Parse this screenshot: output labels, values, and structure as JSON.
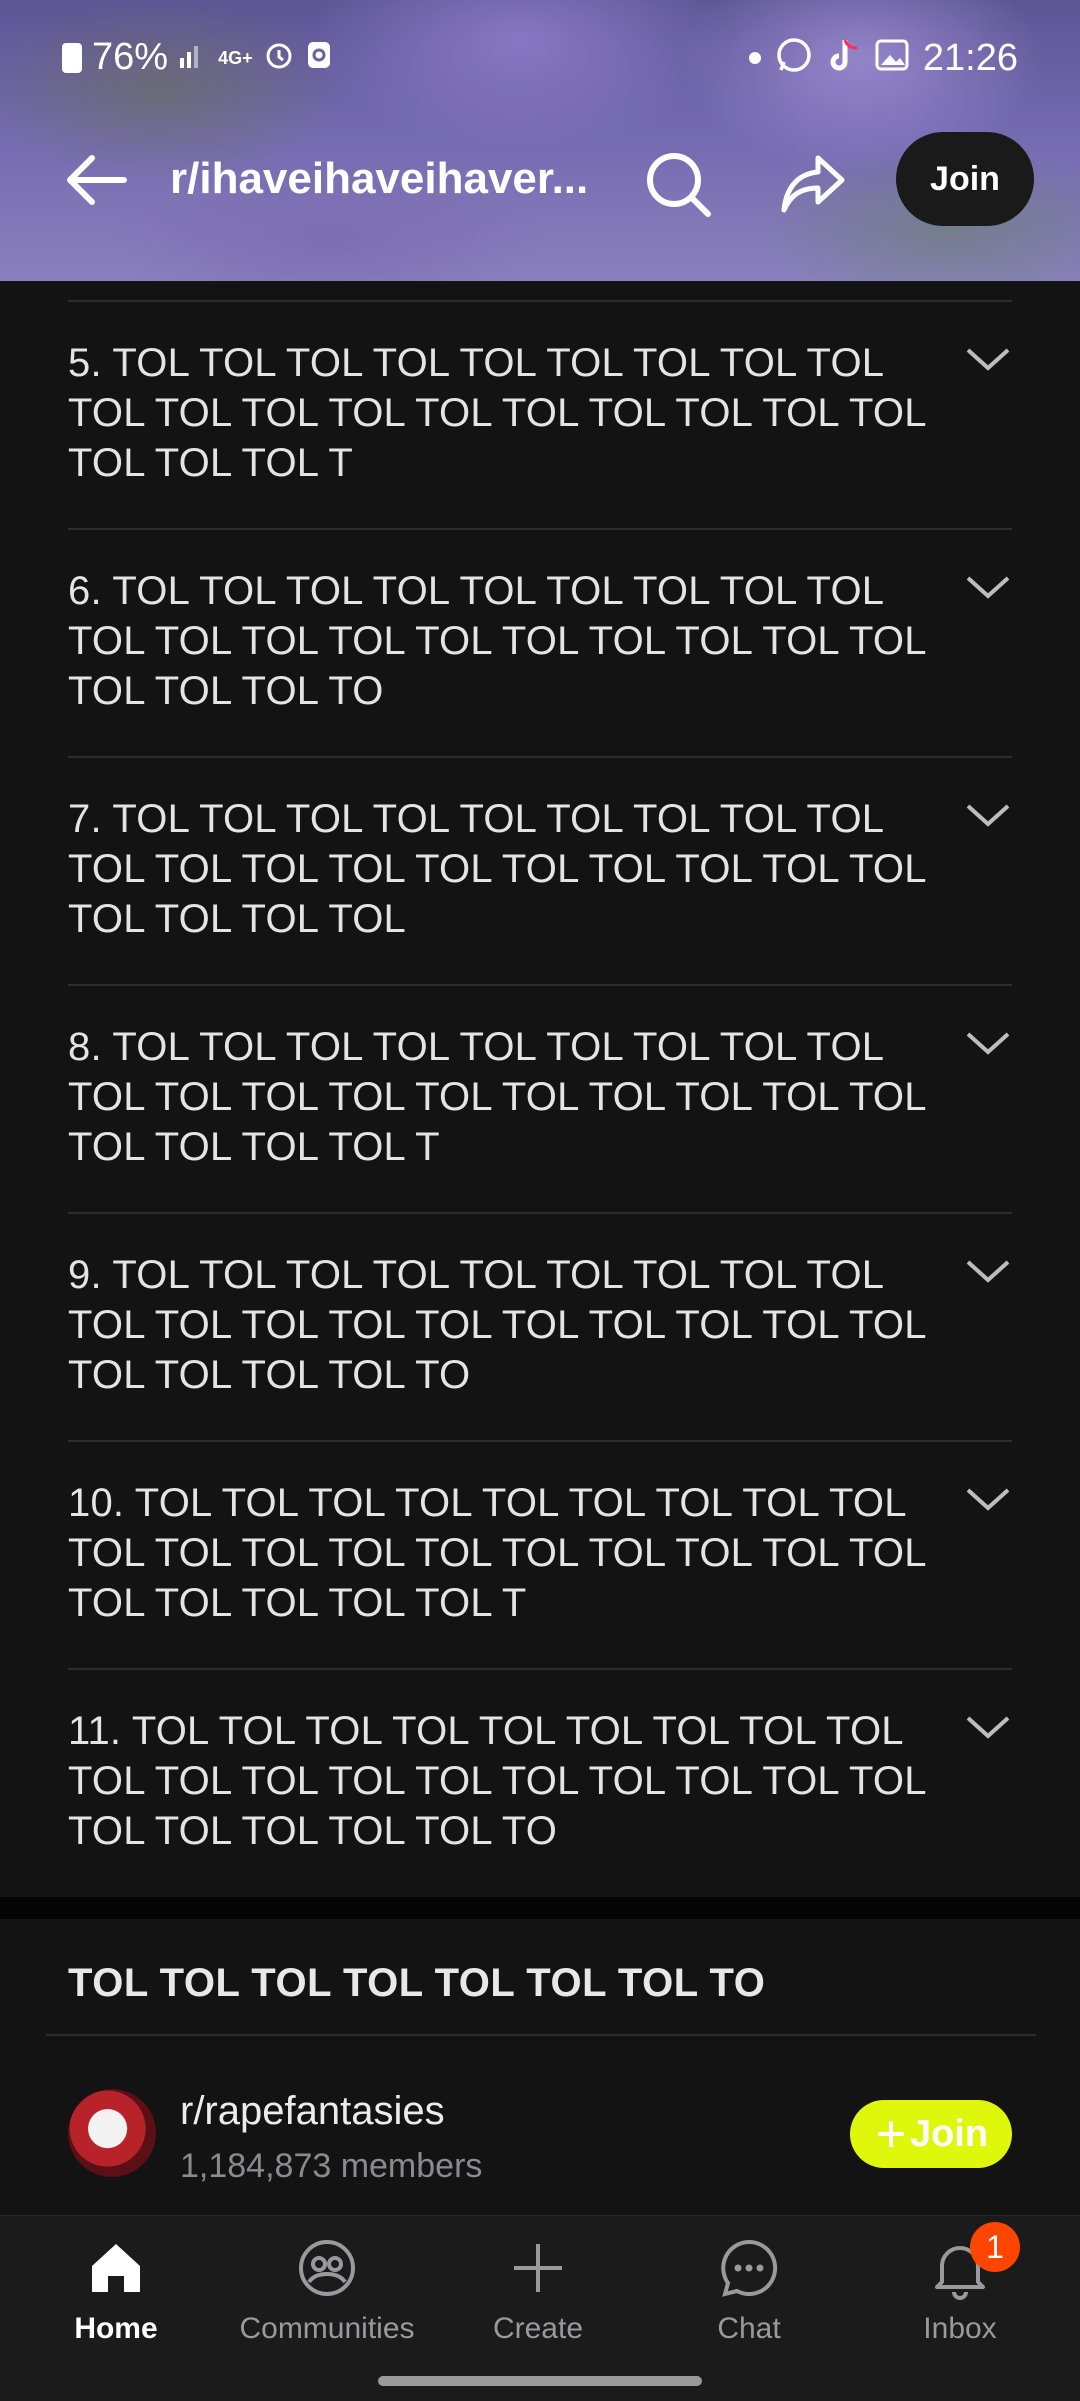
{
  "status_bar": {
    "battery": "76%",
    "network": "4G+",
    "time": "21:26"
  },
  "header": {
    "subreddit_title": "r/ihaveihaveihaver...",
    "join_label": "Join"
  },
  "rules": [
    {
      "text": "5. TOL TOL TOL TOL TOL TOL TOL TOL TOL TOL TOL TOL TOL TOL TOL TOL TOL TOL TOL TOL TOL TOL T"
    },
    {
      "text": "6. TOL TOL TOL TOL TOL TOL TOL TOL TOL TOL TOL TOL TOL TOL TOL TOL TOL TOL TOL TOL TOL TOL TO"
    },
    {
      "text": "7. TOL TOL TOL TOL TOL TOL TOL TOL TOL TOL TOL TOL TOL TOL TOL TOL TOL TOL TOL TOL TOL TOL TOL"
    },
    {
      "text": "8. TOL TOL TOL TOL TOL TOL TOL TOL TOL TOL TOL TOL TOL TOL TOL TOL TOL TOL TOL TOL TOL TOL TOL T"
    },
    {
      "text": "9. TOL TOL TOL TOL TOL TOL TOL TOL TOL TOL TOL TOL TOL TOL TOL TOL TOL TOL TOL TOL TOL TOL TOL TO"
    },
    {
      "text": "10. TOL TOL TOL TOL TOL TOL TOL TOL TOL TOL TOL TOL TOL TOL TOL TOL TOL TOL TOL TOL TOL TOL TOL TOL T"
    },
    {
      "text": "11. TOL TOL TOL TOL TOL TOL TOL TOL TOL TOL TOL TOL TOL TOL TOL TOL TOL TOL TOL TOL TOL TOL TOL TOL TO"
    }
  ],
  "related_section": {
    "heading": "TOL TOL TOL TOL TOL TOL TOL TO",
    "community_name": "r/rapefantasies",
    "members": "1,184,873 members",
    "join_label": "Join",
    "join_color": "#dff70a"
  },
  "bottom_nav": {
    "items": [
      {
        "label": "Home",
        "icon": "home-icon"
      },
      {
        "label": "Communities",
        "icon": "communities-icon"
      },
      {
        "label": "Create",
        "icon": "plus-icon"
      },
      {
        "label": "Chat",
        "icon": "chat-icon"
      },
      {
        "label": "Inbox",
        "icon": "bell-icon"
      }
    ],
    "inbox_badge": "1"
  }
}
